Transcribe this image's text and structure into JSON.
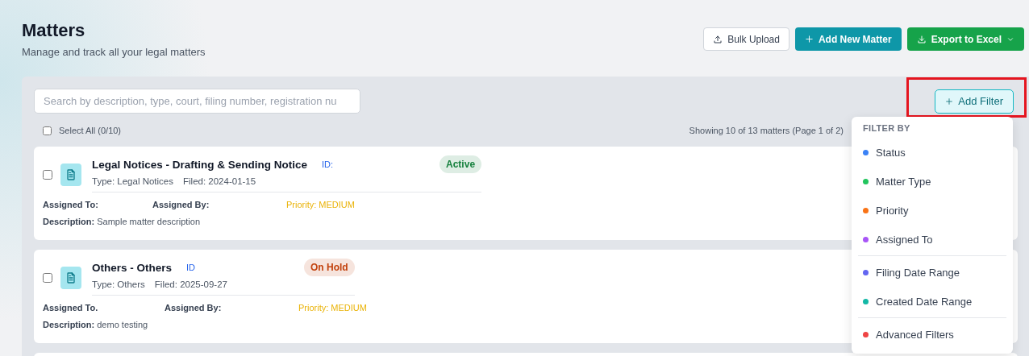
{
  "page": {
    "title": "Matters",
    "subtitle": "Manage and track all your legal matters"
  },
  "actions": [
    {
      "label": "Bulk Upload",
      "kind": "upload"
    },
    {
      "label": "Add New Matter",
      "kind": "add"
    },
    {
      "label": "Export to Excel",
      "kind": "export"
    }
  ],
  "search": {
    "placeholder": "Search by description, type, court, filing number, registration nu"
  },
  "add_filter": {
    "label": "Add Filter",
    "annotated": true
  },
  "select_all": {
    "label": "Select All (0/10)",
    "checked": false
  },
  "summary": "Showing 10 of 13 matters (Page 1 of 2)",
  "matters": [
    {
      "title": "Legal Notices - Drafting & Sending Notice",
      "id_label": "ID:",
      "status": "Active",
      "color": "#15803d",
      "type": "Type: Legal Notices",
      "filed": "Filed: 2024-01-15",
      "assigned_to_label": "Assigned To:",
      "assigned_by_label": "Assigned By:",
      "priority": "Priority: MEDIUM",
      "description_label": "Description:",
      "description": "Sample matter description",
      "checked": false
    },
    {
      "title": "Others - Others",
      "id_label": "ID",
      "status": "On Hold",
      "color": "#c2410c",
      "type": "Type: Others",
      "filed": "Filed: 2025-09-27",
      "assigned_to_label": "Assigned To.",
      "assigned_by_label": "Assigned By:",
      "priority": "Priority: MEDIUM",
      "description_label": "Description:",
      "description": "demo testing",
      "checked": false
    }
  ],
  "filter_menu": {
    "heading": "FILTER BY",
    "groups": [
      [
        {
          "label": "Status",
          "color": "#3b82f6"
        },
        {
          "label": "Matter Type",
          "color": "#22c55e"
        },
        {
          "label": "Priority",
          "color": "#f97316"
        },
        {
          "label": "Assigned To",
          "color": "#a855f7"
        }
      ],
      [
        {
          "label": "Filing Date Range",
          "color": "#6366f1"
        },
        {
          "label": "Created Date Range",
          "color": "#14b8a6"
        }
      ],
      [
        {
          "label": "Advanced Filters",
          "color": "#ef4444"
        }
      ]
    ]
  }
}
